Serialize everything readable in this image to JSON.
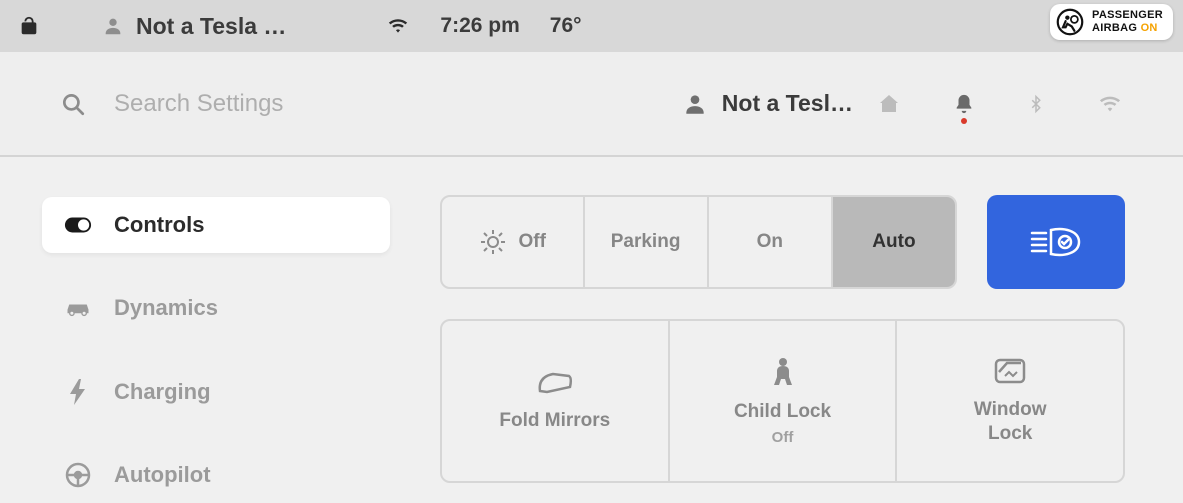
{
  "status_bar": {
    "driver_name": "Not a Tesla …",
    "time": "7:26 pm",
    "temperature": "76°",
    "airbag_line1": "PASSENGER",
    "airbag_line2_a": "AIRBAG ",
    "airbag_line2_b": "ON"
  },
  "settings_header": {
    "search_placeholder": "Search Settings",
    "profile_name": "Not a Tesl…"
  },
  "sidebar": {
    "items": [
      {
        "label": "Controls"
      },
      {
        "label": "Dynamics"
      },
      {
        "label": "Charging"
      },
      {
        "label": "Autopilot"
      }
    ]
  },
  "panel": {
    "lights": {
      "off": "Off",
      "parking": "Parking",
      "on": "On",
      "auto": "Auto"
    },
    "tiles": {
      "fold_mirrors": "Fold Mirrors",
      "child_lock": "Child Lock",
      "child_lock_state": "Off",
      "window_lock_l1": "Window",
      "window_lock_l2": "Lock"
    }
  },
  "colors": {
    "accent": "#3265de"
  }
}
